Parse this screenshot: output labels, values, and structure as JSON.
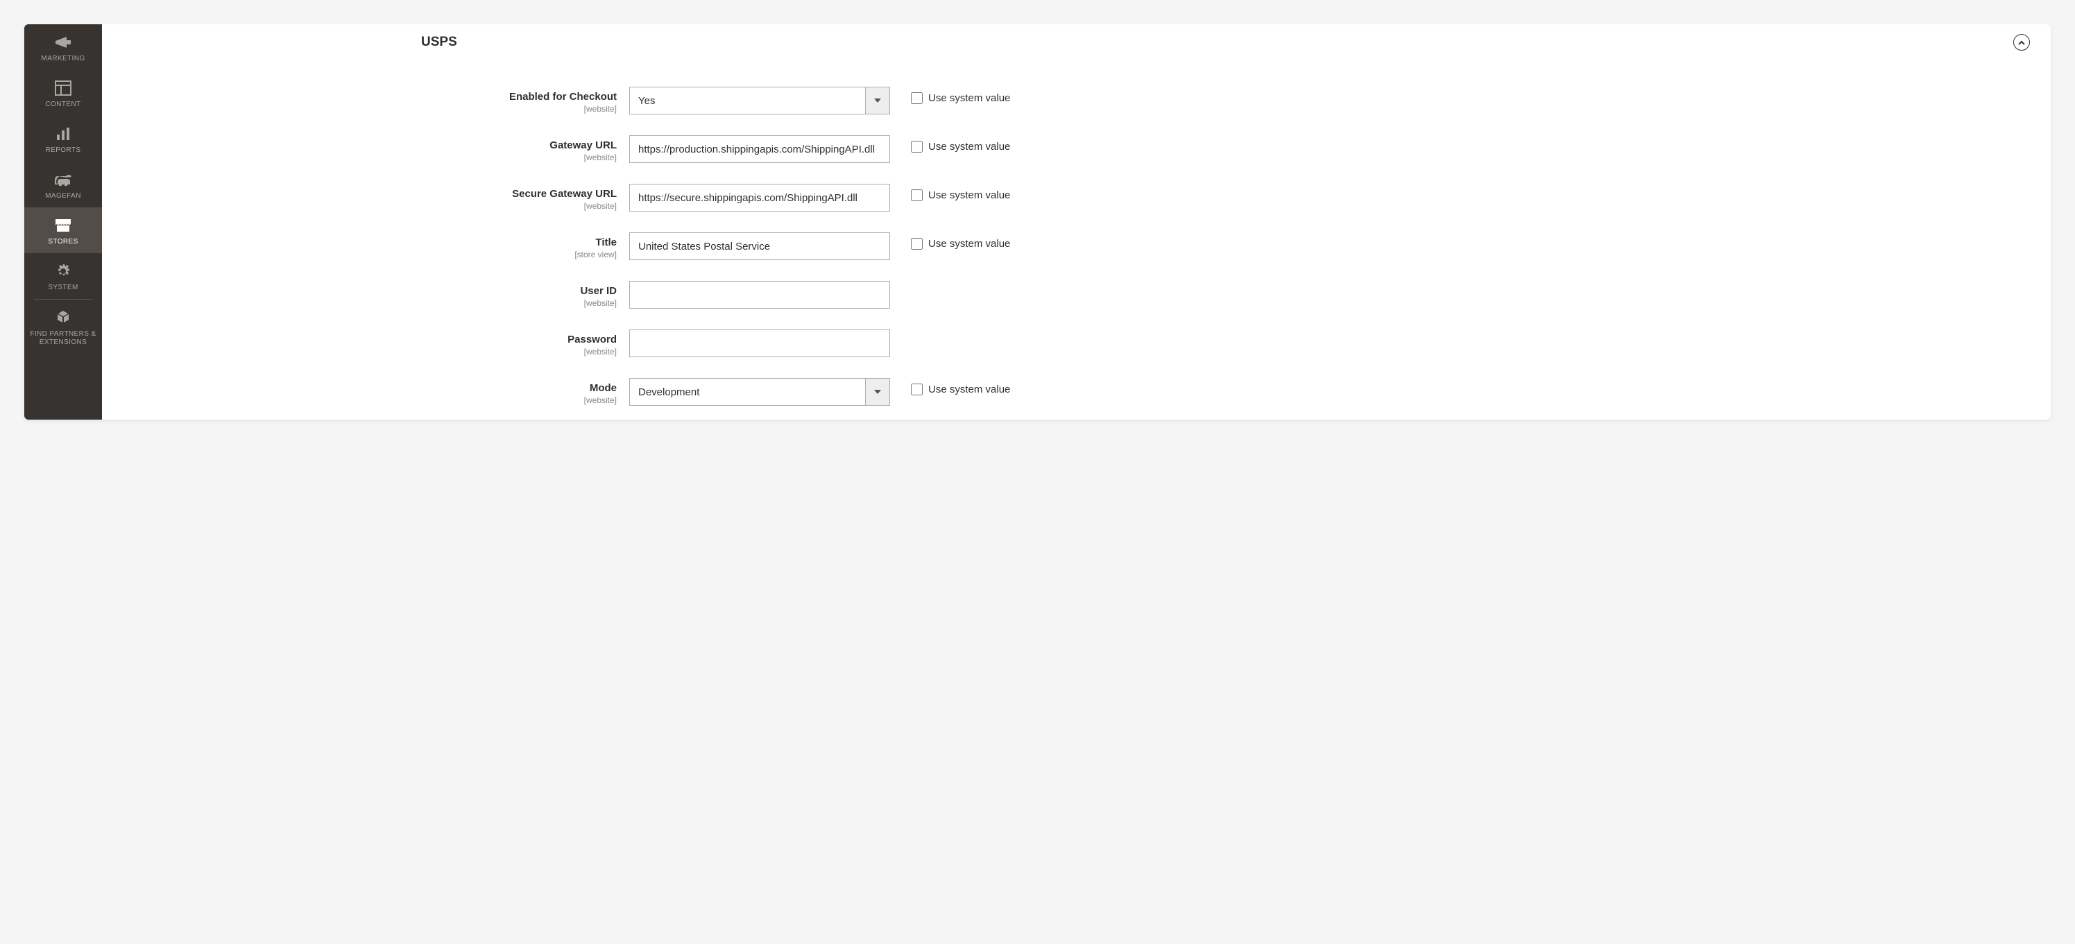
{
  "sidebar": {
    "items": [
      {
        "label": "MARKETING",
        "icon": "megaphone"
      },
      {
        "label": "CONTENT",
        "icon": "layout"
      },
      {
        "label": "REPORTS",
        "icon": "bars"
      },
      {
        "label": "MAGEFAN",
        "icon": "elephant"
      },
      {
        "label": "STORES",
        "icon": "storefront",
        "active": true
      },
      {
        "label": "SYSTEM",
        "icon": "gear"
      },
      {
        "label": "FIND PARTNERS & EXTENSIONS",
        "icon": "blocks"
      }
    ]
  },
  "section": {
    "title": "USPS"
  },
  "checkbox_label": "Use system value",
  "fields": {
    "enabled": {
      "label": "Enabled for Checkout",
      "scope": "[website]",
      "value": "Yes"
    },
    "gateway": {
      "label": "Gateway URL",
      "scope": "[website]",
      "value": "https://production.shippingapis.com/ShippingAPI.dll"
    },
    "secure_gateway": {
      "label": "Secure Gateway URL",
      "scope": "[website]",
      "value": "https://secure.shippingapis.com/ShippingAPI.dll"
    },
    "title": {
      "label": "Title",
      "scope": "[store view]",
      "value": "United States Postal Service"
    },
    "user_id": {
      "label": "User ID",
      "scope": "[website]",
      "value": ""
    },
    "password": {
      "label": "Password",
      "scope": "[website]",
      "value": ""
    },
    "mode": {
      "label": "Mode",
      "scope": "[website]",
      "value": "Development"
    }
  }
}
